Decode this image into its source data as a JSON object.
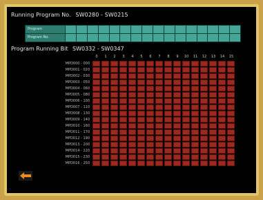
{
  "header": {
    "label": "Running Program No.",
    "range": "SW0280 - SW0215"
  },
  "program_table": {
    "rows": [
      {
        "label": "Program"
      },
      {
        "label": "Program No."
      }
    ],
    "columns": 16
  },
  "bit_section": {
    "label": "Program Running Bit",
    "range": "SW0332 - SW0347"
  },
  "columns": [
    "0",
    "1",
    "2",
    "3",
    "4",
    "5",
    "6",
    "7",
    "8",
    "9",
    "10",
    "11",
    "12",
    "13",
    "14",
    "15"
  ],
  "rows": [
    "MPD000 - 000",
    "MPD001 - 020",
    "MPD002 - 030",
    "MPD003 - 050",
    "MPD004 - 060",
    "MPD005 - 080",
    "MPD006 - 100",
    "MPD007 - 110",
    "MPD008 - 130",
    "MPD009 - 140",
    "MPD010 - 160",
    "MPD011 - 170",
    "MPD012 - 190",
    "MPD013 - 200",
    "MPD014 - 220",
    "MPD015 - 230",
    "MPD016 - 250"
  ],
  "colors": {
    "cell_off": "#9a2a20",
    "table_bg": "#3f9a8c",
    "back_arrow": "#f08a1e"
  },
  "icons": {
    "back": "back-arrow-icon"
  }
}
